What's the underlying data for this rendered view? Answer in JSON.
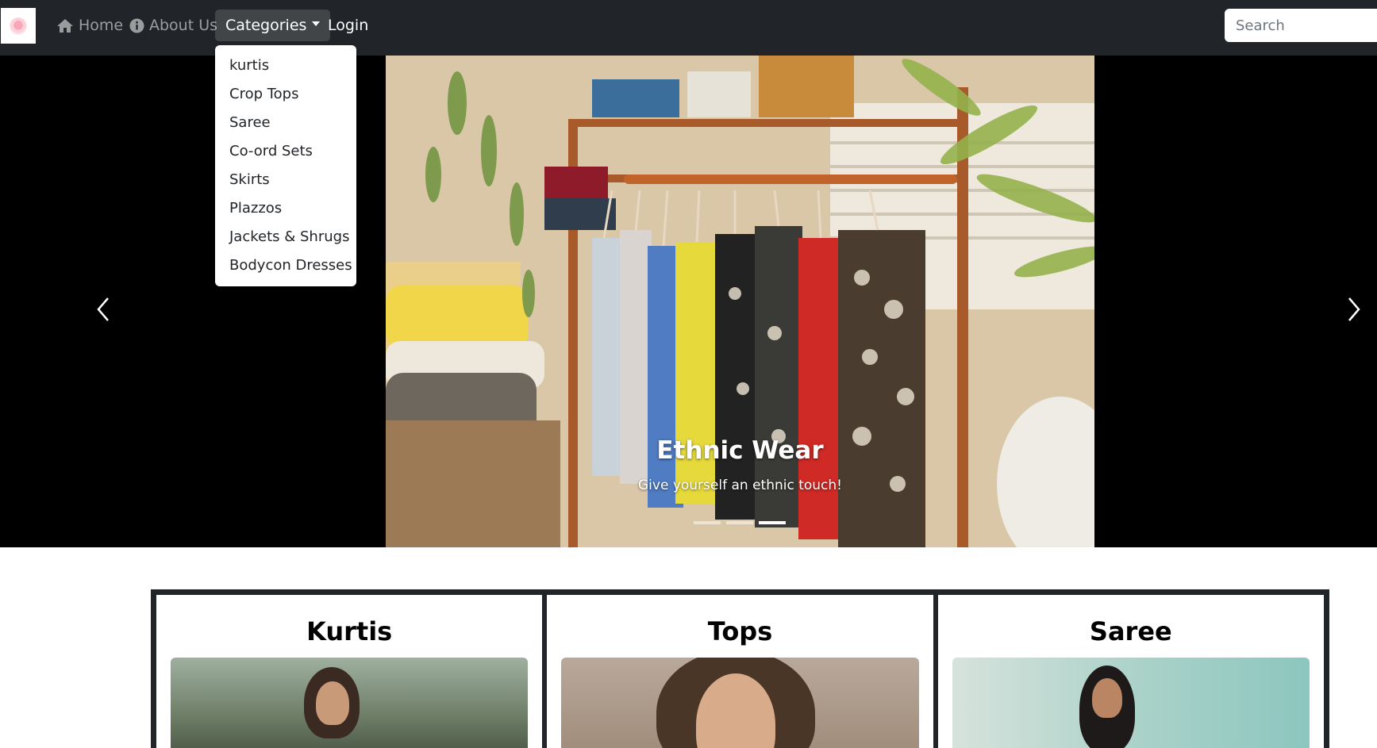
{
  "navbar": {
    "home_label": "Home",
    "about_label": "About Us",
    "categories_label": "Categories",
    "login_label": "Login",
    "search_placeholder": "Search"
  },
  "dropdown": {
    "items": [
      "kurtis",
      "Crop Tops",
      "Saree",
      "Co-ord Sets",
      "Skirts",
      "Plazzos",
      "Jackets & Shrugs",
      "Bodycon Dresses"
    ]
  },
  "carousel": {
    "caption_title": "Ethnic Wear",
    "caption_subtitle": "Give yourself an ethnic touch!",
    "slide_count": 3,
    "active_slide": 3
  },
  "categories": {
    "cards": [
      {
        "title": "Kurtis"
      },
      {
        "title": "Tops"
      },
      {
        "title": "Saree"
      }
    ]
  },
  "colors": {
    "navbar_bg": "#212529",
    "carousel_bg": "#000000",
    "card_border": "#212529"
  }
}
